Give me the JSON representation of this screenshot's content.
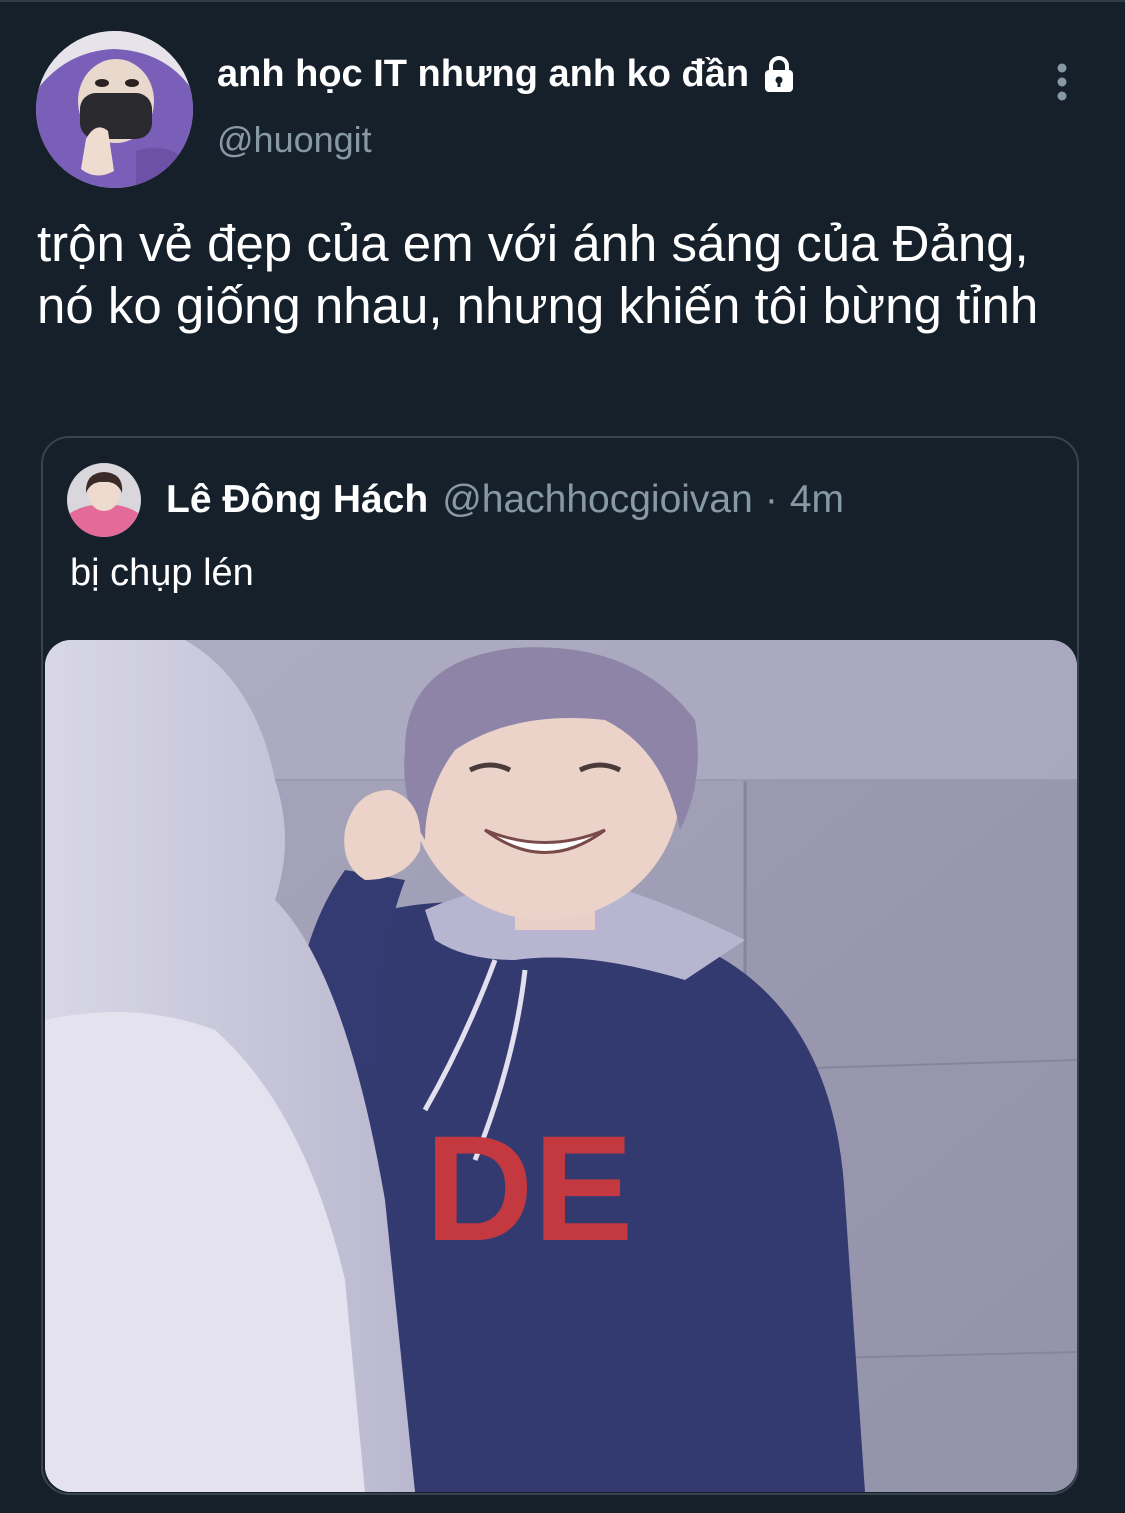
{
  "tweet": {
    "display_name": "anh học IT nhưng anh ko đần",
    "handle": "@huongit",
    "text": "trộn vẻ đẹp của em với ánh sáng của Đảng, nó ko giống nhau, nhưng khiến tôi bừng tỉnh",
    "icons": {
      "avatar": "profile-photo",
      "protected": "lock-icon",
      "menu": "more-vertical-icon"
    }
  },
  "quoted_tweet": {
    "display_name": "Lê Đông Hách",
    "handle": "@hachhocgioivan",
    "separator": "·",
    "time": "4m",
    "text": "bị chụp lén",
    "media_text": "DE"
  },
  "colors": {
    "background": "#15202b",
    "text_primary": "#ffffff",
    "text_secondary": "#8899a6",
    "border": "#38444d"
  }
}
